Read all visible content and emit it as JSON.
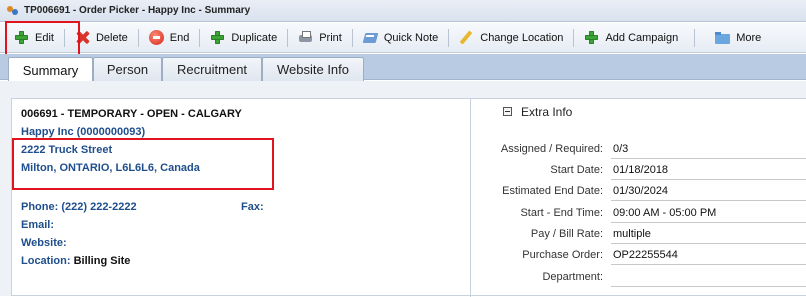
{
  "window": {
    "title": "TP006691 - Order Picker - Happy Inc - Summary"
  },
  "toolbar": {
    "edit": "Edit",
    "delete": "Delete",
    "end": "End",
    "duplicate": "Duplicate",
    "print": "Print",
    "quick_note": "Quick Note",
    "change_location": "Change Location",
    "add_campaign": "Add Campaign",
    "more": "More"
  },
  "tabs": [
    "Summary",
    "Person",
    "Recruitment",
    "Website Info"
  ],
  "summary": {
    "order_heading": "006691 - TEMPORARY - OPEN - CALGARY",
    "company": "Happy Inc (0000000093)",
    "address_line1": "2222 Truck Street",
    "address_line2": "Milton, ONTARIO, L6L6L6, Canada",
    "phone_label": "Phone:",
    "phone_value": "(222) 222-2222",
    "fax_label": "Fax:",
    "email_label": "Email:",
    "website_label": "Website:",
    "location_label": "Location:",
    "location_value": "Billing Site"
  },
  "extra_info": {
    "title": "Extra Info",
    "fields": [
      {
        "label": "Assigned / Required:",
        "value": "0/3"
      },
      {
        "label": "Start Date:",
        "value": "01/18/2018"
      },
      {
        "label": "Estimated End Date:",
        "value": "01/30/2024"
      },
      {
        "label": "Start - End Time:",
        "value": "09:00 AM - 05:00 PM"
      },
      {
        "label": "Pay / Bill Rate:",
        "value": "multiple"
      },
      {
        "label": "Purchase Order:",
        "value": "OP22255544"
      },
      {
        "label": "Department:",
        "value": ""
      }
    ]
  },
  "icons": {
    "app": "app-icon",
    "edit": "plus-icon",
    "delete": "delete-x-icon",
    "end": "stop-icon",
    "duplicate": "plus-icon",
    "print": "printer-icon",
    "quick_note": "note-icon",
    "change_location": "pencil-icon",
    "add_campaign": "plus-icon",
    "more": "folder-icon"
  },
  "colors": {
    "highlight": "#e0141e",
    "link_blue": "#1f4e8c",
    "tab_bar": "#b8cbe3"
  }
}
